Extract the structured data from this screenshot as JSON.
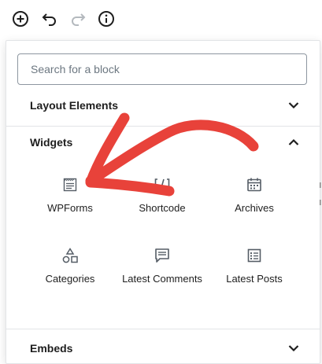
{
  "toolbar": {
    "add_icon": "plus-circle-icon",
    "undo_icon": "undo-icon",
    "redo_icon": "redo-icon",
    "info_icon": "info-icon"
  },
  "search": {
    "placeholder": "Search for a block",
    "value": ""
  },
  "panels": {
    "layout": {
      "title": "Layout Elements",
      "expanded": false
    },
    "widgets": {
      "title": "Widgets",
      "expanded": true
    },
    "embeds": {
      "title": "Embeds",
      "expanded": false
    }
  },
  "widgets": [
    {
      "label": "WPForms",
      "icon": "wpforms-icon"
    },
    {
      "label": "Shortcode",
      "icon": "shortcode-icon"
    },
    {
      "label": "Archives",
      "icon": "calendar-icon"
    },
    {
      "label": "Categories",
      "icon": "categories-icon"
    },
    {
      "label": "Latest Comments",
      "icon": "comment-icon"
    },
    {
      "label": "Latest Posts",
      "icon": "list-icon"
    }
  ],
  "colors": {
    "annotation_arrow": "#e8423a",
    "icon": "#555d66",
    "text": "#1e1e1e"
  }
}
